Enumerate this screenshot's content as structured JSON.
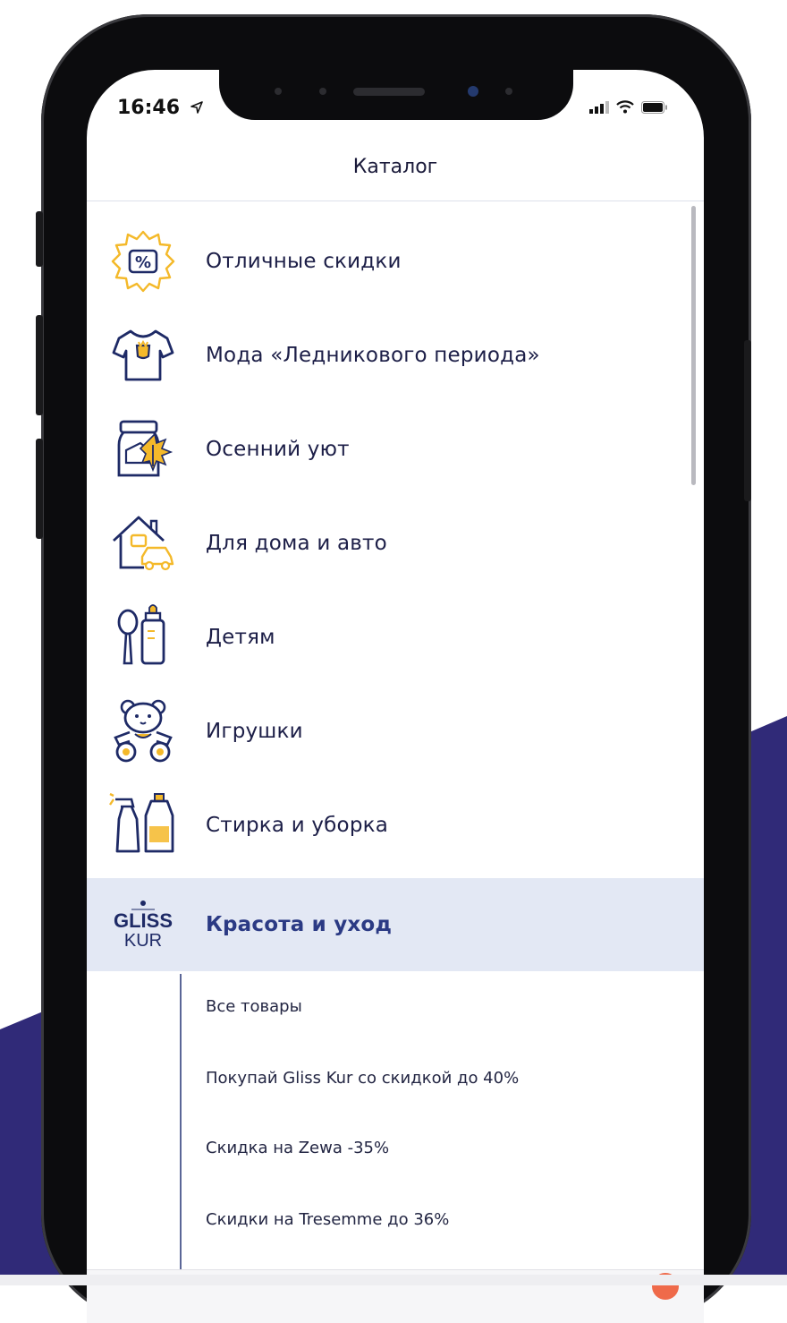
{
  "status_bar": {
    "time": "16:46"
  },
  "nav": {
    "title": "Каталог"
  },
  "categories": [
    {
      "label": "Отличные скидки",
      "icon": "discount-badge-icon"
    },
    {
      "label": "Мода «Ледникового периода»",
      "icon": "tshirt-icon"
    },
    {
      "label": "Осенний уют",
      "icon": "jar-leaf-icon"
    },
    {
      "label": "Для дома и авто",
      "icon": "house-car-icon"
    },
    {
      "label": "Детям",
      "icon": "spoon-bottle-icon"
    },
    {
      "label": "Игрушки",
      "icon": "teddy-bear-icon"
    },
    {
      "label": "Стирка и уборка",
      "icon": "cleaning-bottles-icon"
    },
    {
      "label": "Красота и уход",
      "icon": "gliss-kur-logo",
      "active": true,
      "logo_text": [
        "GLISS",
        "KUR"
      ]
    }
  ],
  "subcategories": [
    {
      "label": "Все товары"
    },
    {
      "label": "Покупай Gliss Kur со скидкой до 40%"
    },
    {
      "label": "Скидка на Zewa -35%"
    },
    {
      "label": "Скидки на Tresemme до 36%"
    }
  ],
  "colors": {
    "accent_yellow": "#f4b92a",
    "icon_navy": "#1e2a66",
    "background_purple": "#302a78",
    "active_row": "#e3e8f4"
  }
}
